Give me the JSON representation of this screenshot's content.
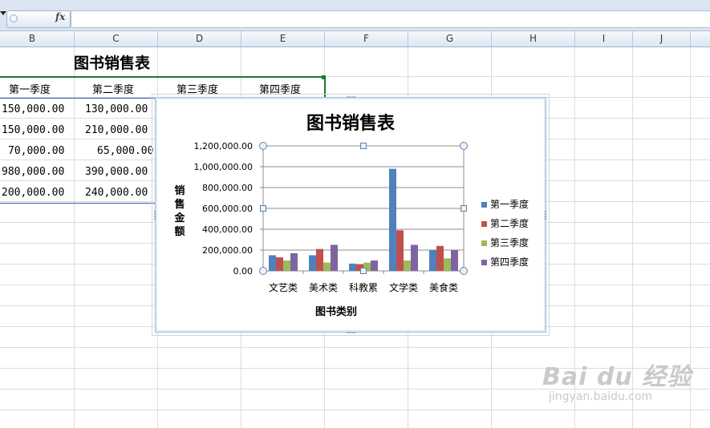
{
  "formula_bar": {
    "fx_label": "fx",
    "value": ""
  },
  "columns": [
    "B",
    "C",
    "D",
    "E",
    "F",
    "G",
    "H",
    "I",
    "J"
  ],
  "sheet": {
    "title": "图书销售表",
    "headers": [
      "第一季度",
      "第二季度",
      "第三季度",
      "第四季度"
    ],
    "rows": [
      [
        "150,000.00",
        "130,000.00"
      ],
      [
        "150,000.00",
        "210,000.00"
      ],
      [
        "70,000.00",
        "65,000.00"
      ],
      [
        "980,000.00",
        "390,000.00"
      ],
      [
        "200,000.00",
        "240,000.00"
      ]
    ]
  },
  "chart_data": {
    "type": "bar",
    "title": "图书销售表",
    "xlabel": "图书类别",
    "ylabel": "销售金额",
    "categories": [
      "文艺类",
      "美术类",
      "科教累",
      "文学类",
      "美食类"
    ],
    "series": [
      {
        "name": "第一季度",
        "color": "#4f81bd",
        "values": [
          150000,
          150000,
          70000,
          980000,
          200000
        ]
      },
      {
        "name": "第二季度",
        "color": "#c0504d",
        "values": [
          130000,
          210000,
          65000,
          390000,
          240000
        ]
      },
      {
        "name": "第三季度",
        "color": "#9bbb59",
        "values": [
          100000,
          80000,
          80000,
          100000,
          120000
        ]
      },
      {
        "name": "第四季度",
        "color": "#8064a2",
        "values": [
          170000,
          250000,
          100000,
          250000,
          200000
        ]
      }
    ],
    "ylim": [
      0,
      1200000
    ],
    "yticks": [
      "0.00",
      "200,000.00",
      "400,000.00",
      "600,000.00",
      "800,000.00",
      "1,000,000.00",
      "1,200,000.00"
    ],
    "legend": "right",
    "grid": true
  },
  "watermark": {
    "main": "Bai du 经验",
    "sub": "jingyan.baidu.com"
  }
}
